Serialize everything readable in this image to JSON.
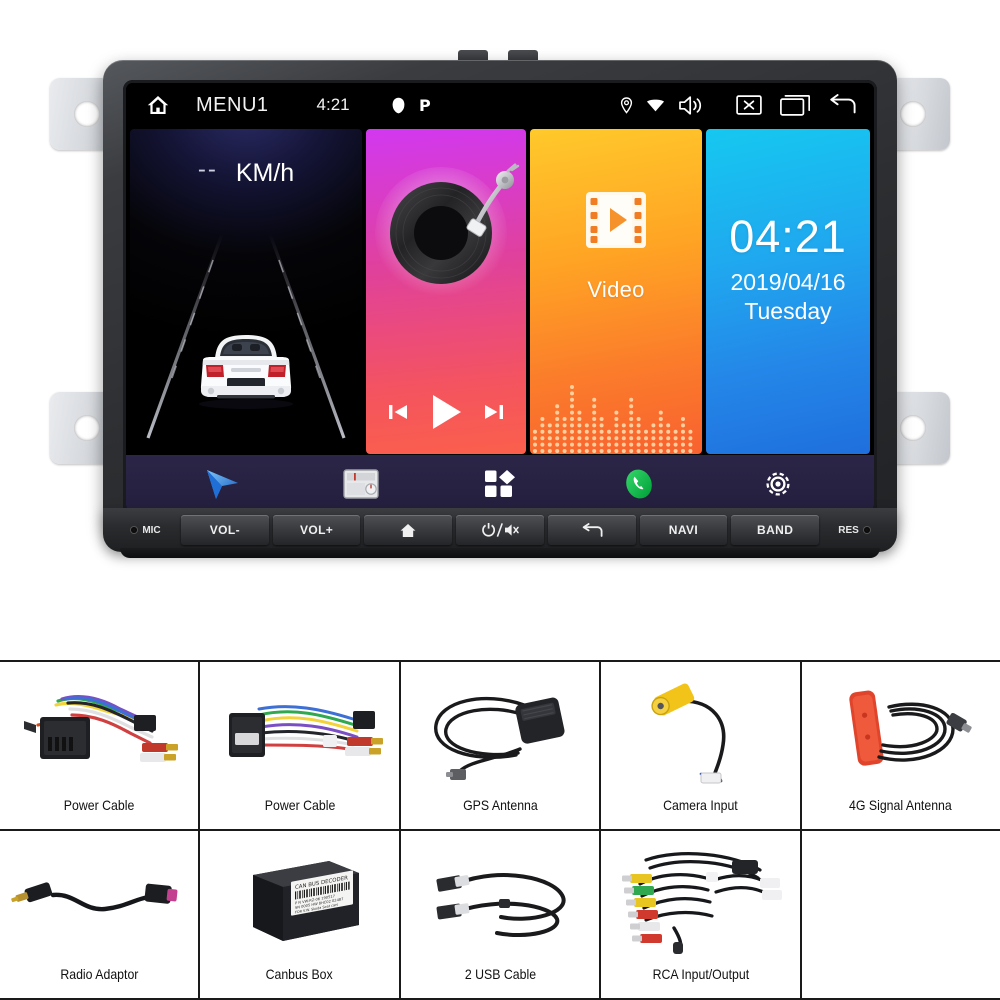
{
  "head_unit": {
    "status_bar": {
      "home_icon": "home-icon",
      "menu_label": "MENU1",
      "clock": "4:21",
      "bluetooth_icon": "bluetooth-icon",
      "parking_icon": "parking-p-icon",
      "location_icon": "location-pin-icon",
      "wifi_icon": "wifi-icon",
      "volume_icon": "speaker-volume-icon",
      "close_icon": "close-box-icon",
      "recents_icon": "recents-window-icon",
      "back_icon": "back-arrow-icon"
    },
    "tiles": {
      "car": {
        "speed_value": "--",
        "speed_unit": "KM/h",
        "art": "white-car-rear-on-road"
      },
      "music": {
        "art": "vinyl-record-turntable",
        "prev_icon": "previous-track-icon",
        "play_icon": "play-icon",
        "next_icon": "next-track-icon",
        "accent": "#e0419b"
      },
      "video": {
        "art": "film-strip-play-icon",
        "label": "Video",
        "accent": "#fb7c2b"
      },
      "clock": {
        "time": "04:21",
        "date": "2019/04/16",
        "weekday": "Tuesday",
        "accent": "#1fa9ef"
      }
    },
    "dock": [
      {
        "name": "navigation",
        "icon": "navigation-arrow-icon"
      },
      {
        "name": "radio",
        "icon": "radio-tuner-icon"
      },
      {
        "name": "apps",
        "icon": "apps-grid-icon"
      },
      {
        "name": "phone",
        "icon": "phone-handset-icon"
      },
      {
        "name": "settings",
        "icon": "settings-gear-icon"
      }
    ],
    "hardware_buttons": {
      "mic_label": "MIC",
      "res_label": "RES",
      "keys": [
        {
          "label": "VOL-",
          "icon": ""
        },
        {
          "label": "VOL+",
          "icon": ""
        },
        {
          "label": "",
          "icon": "home-icon"
        },
        {
          "label": "",
          "icon": "power-mute-icon"
        },
        {
          "label": "",
          "icon": "back-arrow-icon"
        },
        {
          "label": "NAVI",
          "icon": ""
        },
        {
          "label": "BAND",
          "icon": ""
        }
      ]
    }
  },
  "accessories": {
    "rows": [
      [
        {
          "label": "Power Cable",
          "art": "power-harness-iso-connector"
        },
        {
          "label": "Power Cable",
          "art": "power-harness-iso-connector-2"
        },
        {
          "label": "GPS Antenna",
          "art": "gps-antenna-puck-cable"
        },
        {
          "label": "Camera Input",
          "art": "camera-input-rca-yellow"
        },
        {
          "label": "4G Signal Antenna",
          "art": "4g-antenna-red-patch"
        }
      ],
      [
        {
          "label": "Radio Adaptor",
          "art": "radio-antenna-adaptor"
        },
        {
          "label": "Canbus Box",
          "art": "canbus-decoder-box"
        },
        {
          "label": "2 USB Cable",
          "art": "usb-cable-pair"
        },
        {
          "label": "RCA Input/Output",
          "art": "rca-av-harness"
        },
        {
          "label": "",
          "art": ""
        }
      ]
    ],
    "canbus_box": {
      "title": "CAN BUS DECODER",
      "line1": "P N  VW-RZ-06          190517",
      "line2": "SN  0005      HW  8HC02         02487",
      "line3": "FOR V.W. Skoda Seat cars"
    }
  }
}
